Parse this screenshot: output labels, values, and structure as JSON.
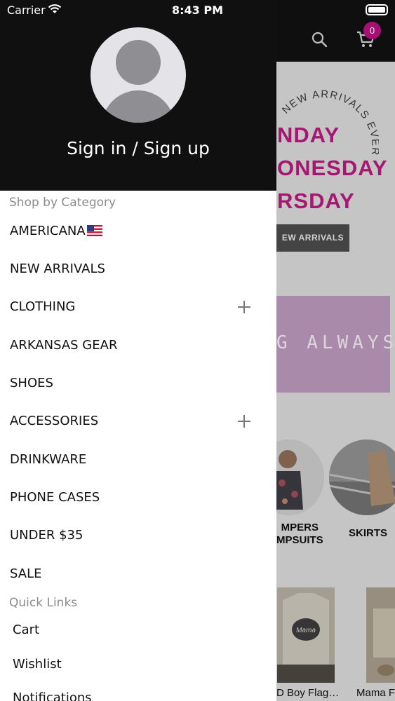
{
  "status_bar": {
    "carrier": "Carrier",
    "time": "8:43 PM"
  },
  "drawer": {
    "sign_in_label": "Sign in / Sign up",
    "shop_section_title": "Shop by Category",
    "categories": [
      {
        "label": "AMERICANA",
        "has_flag": true,
        "expandable": false
      },
      {
        "label": "NEW ARRIVALS",
        "expandable": false
      },
      {
        "label": "CLOTHING",
        "expandable": true
      },
      {
        "label": "ARKANSAS GEAR",
        "expandable": false
      },
      {
        "label": "SHOES",
        "expandable": false
      },
      {
        "label": "ACCESSORIES",
        "expandable": true
      },
      {
        "label": "DRINKWARE",
        "expandable": false
      },
      {
        "label": "PHONE CASES",
        "expandable": false
      },
      {
        "label": "UNDER $35",
        "expandable": false
      },
      {
        "label": "SALE",
        "expandable": false
      }
    ],
    "quick_links_title": "Quick Links",
    "quick_links": [
      "Cart",
      "Wishlist",
      "Notifications"
    ]
  },
  "background": {
    "cart_count": "0",
    "arc_text": "NEW ARRIVALS EVERY",
    "promo_lines": [
      "NDAY",
      "ONESDAY",
      "RSDAY"
    ],
    "new_arrivals_button": "EW ARRIVALS",
    "banner_text": "G ALWAYS",
    "category_circles": [
      {
        "label_line1": "MPERS",
        "label_line2": "MPSUITS"
      },
      {
        "label_line1": "SKIRTS"
      }
    ],
    "products": [
      "D Boy Flag…",
      "Mama F"
    ],
    "accent_color": "#b51a7c"
  }
}
